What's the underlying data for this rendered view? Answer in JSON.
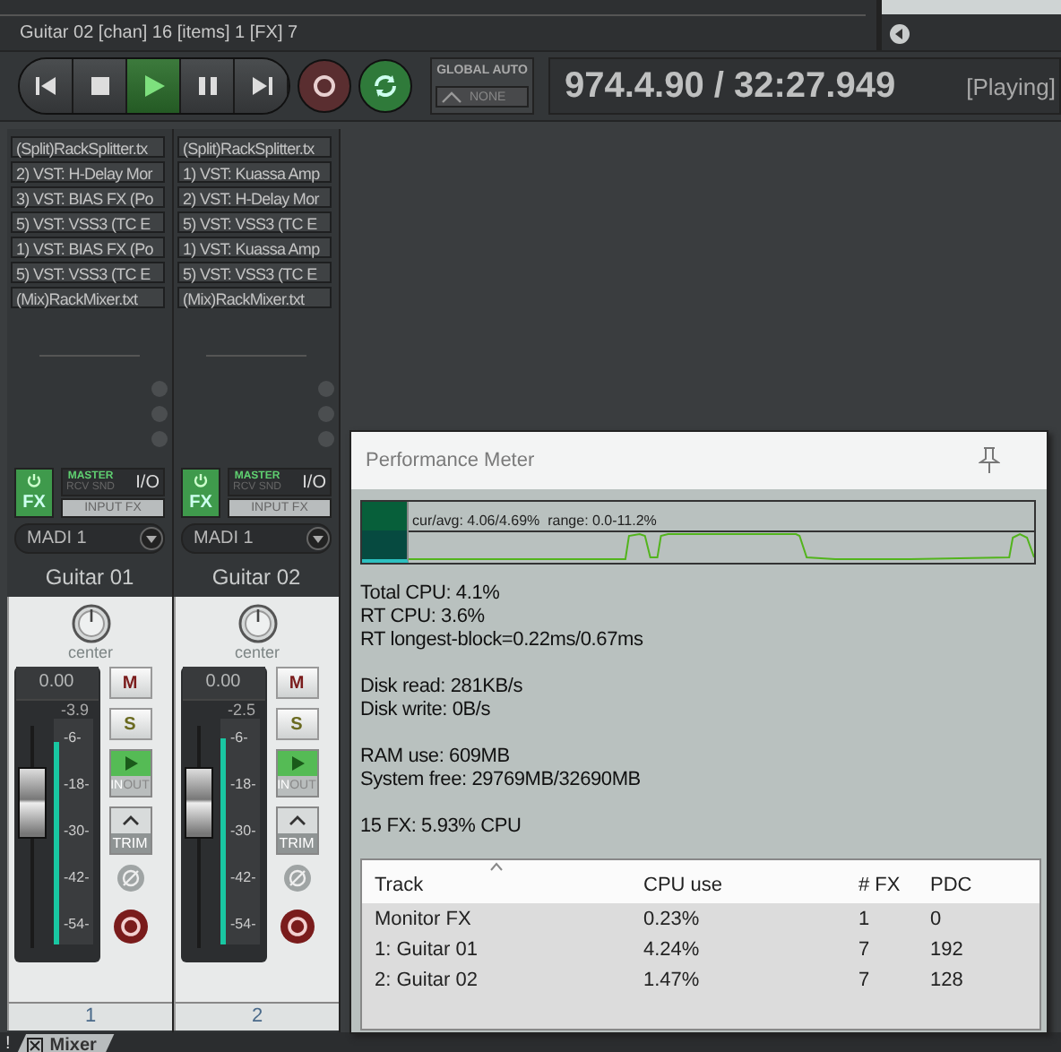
{
  "status_bar": {
    "text": "Guitar 02 [chan] 16 [items] 1 [FX] 7"
  },
  "transport": {
    "buttons": [
      {
        "kind": "start",
        "on": false
      },
      {
        "kind": "stop",
        "on": false
      },
      {
        "kind": "play",
        "on": true
      },
      {
        "kind": "pause",
        "on": false
      },
      {
        "kind": "end",
        "on": false
      }
    ],
    "record": {
      "on": false
    },
    "repeat": {
      "on": true
    },
    "global_auto": {
      "label": "GLOBAL AUTO",
      "mode": "NONE"
    },
    "time": "974.4.90 / 32:27.949",
    "state": "[Playing]"
  },
  "mixer": {
    "strips": [
      {
        "name": "Guitar 01",
        "number": "1",
        "fx": [
          "(Split)RackSplitter.tx",
          "2) VST: H-Delay Mor",
          "3) VST: BIAS FX (Po",
          "5) VST: VSS3 (TC E",
          "1) VST: BIAS FX (Po",
          "5) VST: VSS3 (TC E",
          "(Mix)RackMixer.txt"
        ],
        "fx_enabled": true,
        "fx_label": "FX",
        "master_label": "MASTER",
        "rcv_snd_label": "RCV SND",
        "io_label": "I/O",
        "input_fx_label": "INPUT FX",
        "input": "MADI 1",
        "pan": "center",
        "volume": "0.00",
        "peak": "-3.9",
        "fader": {
          "level": 0.72
        },
        "meter": {
          "level": 0.9
        },
        "scale": [
          "-6-",
          "-18-",
          "-30-",
          "-42-",
          "-54-"
        ],
        "mute_label": "M",
        "solo_label": "S",
        "monitor": true,
        "in_label": "IN",
        "out_label": "OUT",
        "trim_label": "TRIM"
      },
      {
        "name": "Guitar 02",
        "number": "2",
        "fx": [
          "(Split)RackSplitter.tx",
          "1) VST: Kuassa Amp",
          "2) VST: H-Delay Mor",
          "5) VST: VSS3 (TC E",
          "1) VST: Kuassa Amp",
          "5) VST: VSS3 (TC E",
          "(Mix)RackMixer.txt"
        ],
        "fx_enabled": true,
        "fx_label": "FX",
        "master_label": "MASTER",
        "rcv_snd_label": "RCV SND",
        "io_label": "I/O",
        "input_fx_label": "INPUT FX",
        "input": "MADI 1",
        "pan": "center",
        "volume": "0.00",
        "peak": "-2.5",
        "fader": {
          "level": 0.72
        },
        "meter": {
          "level": 0.91
        },
        "scale": [
          "-6-",
          "-18-",
          "-30-",
          "-42-",
          "-54-"
        ],
        "mute_label": "M",
        "solo_label": "S",
        "monitor": true,
        "in_label": "IN",
        "out_label": "OUT",
        "trim_label": "TRIM"
      }
    ]
  },
  "performance_meter": {
    "title": "Performance Meter",
    "graph_label": "cur/avg: 4.06/4.69%  range: 0.0-11.2%",
    "stats": [
      [
        "Total CPU: 4.1%",
        "RT CPU: 3.6%",
        "RT longest-block=0.22ms/0.67ms"
      ],
      [
        "Disk read: 281KB/s",
        "Disk write: 0B/s"
      ],
      [
        "RAM use: 609MB",
        "System free: 29769MB/32690MB"
      ],
      [
        "15 FX: 5.93% CPU"
      ]
    ],
    "table": {
      "columns": [
        {
          "label": "Track",
          "sorted": true
        },
        {
          "label": "CPU use",
          "sorted": false
        },
        {
          "label": "# FX",
          "sorted": false
        },
        {
          "label": "PDC",
          "sorted": false
        }
      ],
      "rows": [
        [
          "Monitor FX",
          "0.23%",
          "1",
          "0"
        ],
        [
          "1: Guitar 01",
          "4.24%",
          "7",
          "192"
        ],
        [
          "2: Guitar 02",
          "1.47%",
          "7",
          "128"
        ]
      ]
    }
  },
  "dock_tab": {
    "label": "Mixer",
    "marker": "!"
  }
}
